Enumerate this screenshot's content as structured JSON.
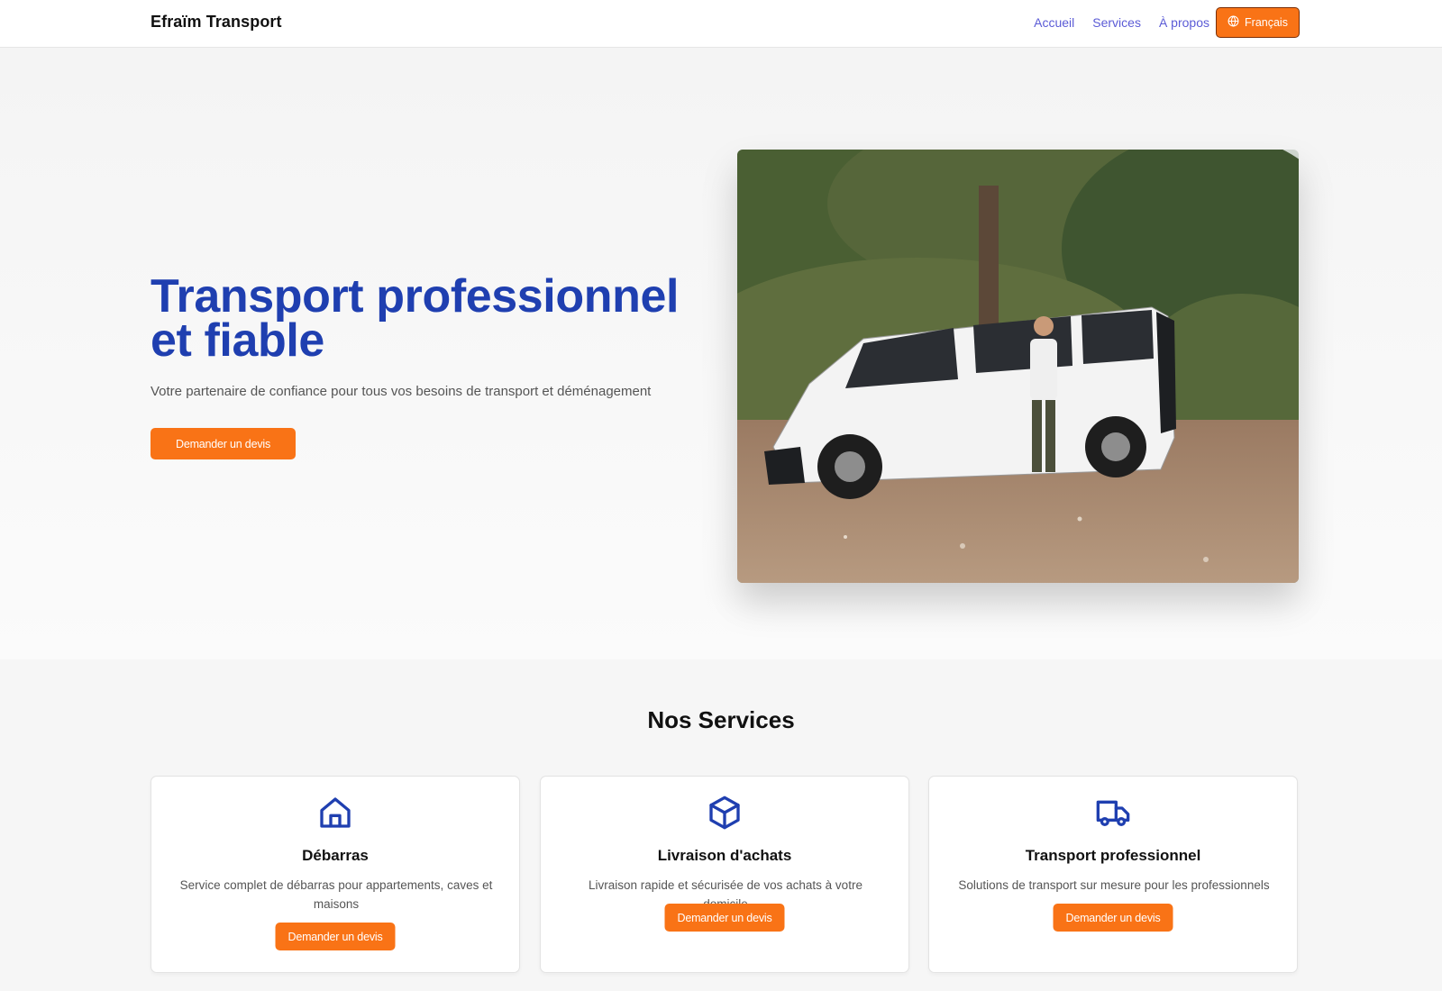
{
  "header": {
    "brand": "Efraïm Transport",
    "nav": [
      "Accueil",
      "Services",
      "À propos"
    ],
    "language": "Français"
  },
  "hero": {
    "title": "Transport professionnel et fiable",
    "subtitle": "Votre partenaire de confiance pour tous vos besoins de transport et déménagement",
    "cta": "Demander un devis"
  },
  "services": {
    "title": "Nos Services",
    "items": [
      {
        "icon": "house-icon",
        "title": "Débarras",
        "description": "Service complet de débarras pour appartements, caves et maisons",
        "cta": "Demander un devis"
      },
      {
        "icon": "box-icon",
        "title": "Livraison d'achats",
        "description": "Livraison rapide et sécurisée de vos achats à votre domicile",
        "cta": "Demander un devis"
      },
      {
        "icon": "truck-icon",
        "title": "Transport professionnel",
        "description": "Solutions de transport sur mesure pour les professionnels",
        "cta": "Demander un devis"
      }
    ]
  },
  "colors": {
    "accent": "#f97316",
    "primary_blue": "#1f3fb0",
    "nav_link": "#5b5bd6"
  }
}
